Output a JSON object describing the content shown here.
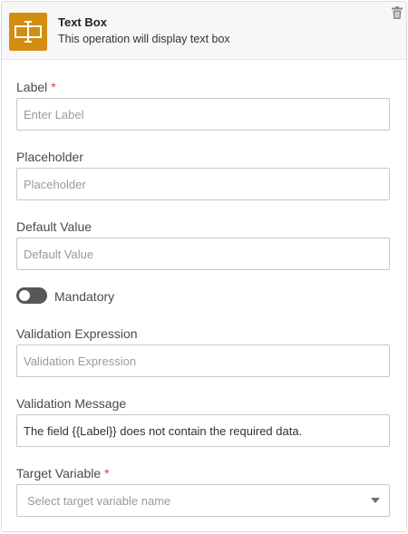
{
  "header": {
    "icon": "text-box-icon",
    "title": "Text Box",
    "subtitle": "This operation will display text box",
    "delete_icon": "trash-icon"
  },
  "colors": {
    "accent": "#d38d12",
    "required": "#d8432b",
    "toggle_off": "#575757"
  },
  "fields": {
    "label": {
      "label": "Label",
      "required_mark": "*",
      "value": "",
      "placeholder": "Enter Label"
    },
    "placeholder": {
      "label": "Placeholder",
      "value": "",
      "placeholder": "Placeholder"
    },
    "default_value": {
      "label": "Default Value",
      "value": "",
      "placeholder": "Default Value"
    },
    "mandatory": {
      "label": "Mandatory",
      "checked": false
    },
    "validation_expression": {
      "label": "Validation Expression",
      "value": "",
      "placeholder": "Validation Expression"
    },
    "validation_message": {
      "label": "Validation Message",
      "value": "The field {{Label}} does not contain the required data.",
      "placeholder": ""
    },
    "target_variable": {
      "label": "Target Variable",
      "required_mark": "*",
      "placeholder": "Select target variable name"
    }
  }
}
